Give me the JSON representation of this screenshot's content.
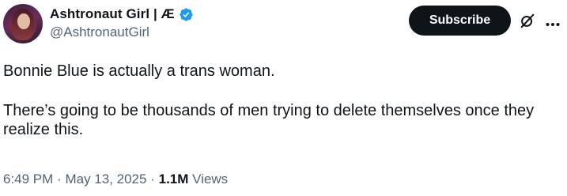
{
  "author": {
    "display_name": "Ashtronaut Girl | Æ",
    "handle": "@AshtronautGirl",
    "verified": true
  },
  "actions": {
    "subscribe_label": "Subscribe",
    "icons": [
      "grok-icon",
      "more-options-icon"
    ]
  },
  "tweet": {
    "paragraphs": [
      "Bonnie Blue is actually a trans woman.",
      "There’s going to be thousands of men trying to delete themselves once they realize this."
    ]
  },
  "meta": {
    "time": "6:49 PM",
    "separator": "·",
    "date": "May 13, 2025",
    "views_count": "1.1M",
    "views_label": "Views"
  },
  "colors": {
    "text": "#0f1419",
    "secondary": "#536471",
    "verified": "#1d9bf0",
    "button_bg": "#0f1419"
  }
}
